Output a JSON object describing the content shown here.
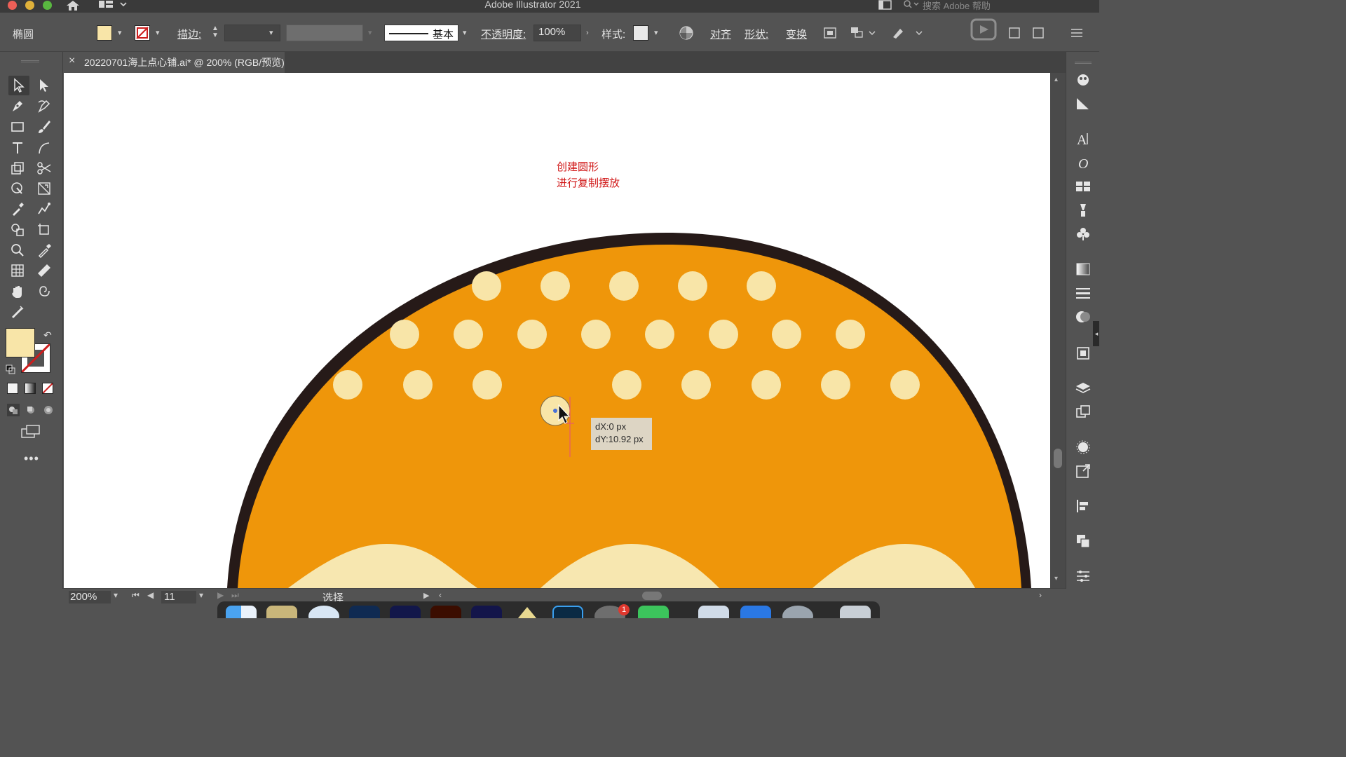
{
  "app": {
    "title": "Adobe Illustrator 2021",
    "search_placeholder": "搜索 Adobe 帮助"
  },
  "controlbar": {
    "object_type": "椭圆",
    "stroke_label": "描边:",
    "brush_style": "基本",
    "opacity_label": "不透明度:",
    "opacity_value": "100%",
    "style_label": "样式:",
    "align_label": "对齐",
    "shape_label": "形状:",
    "transform_label": "变换",
    "fill_color": "#f8e5a8"
  },
  "document": {
    "tab_title": "20220701海上点心铺.ai* @ 200% (RGB/预览)",
    "close_glyph": "×"
  },
  "canvas": {
    "annotation_lines": [
      "创建圆形",
      "进行复制摆放"
    ],
    "tooltip_dx": "dX:0 px",
    "tooltip_dy": "dY:10.92 px",
    "colors": {
      "bun_fill": "#ef960a",
      "bun_outline": "#261a18",
      "dot_fill": "#f8e5a8",
      "cream_fill": "#f7e7b0"
    }
  },
  "statusbar": {
    "zoom": "200%",
    "artboard_number": "11",
    "tool_status": "选择"
  },
  "dock": {
    "badge_count": "1"
  }
}
